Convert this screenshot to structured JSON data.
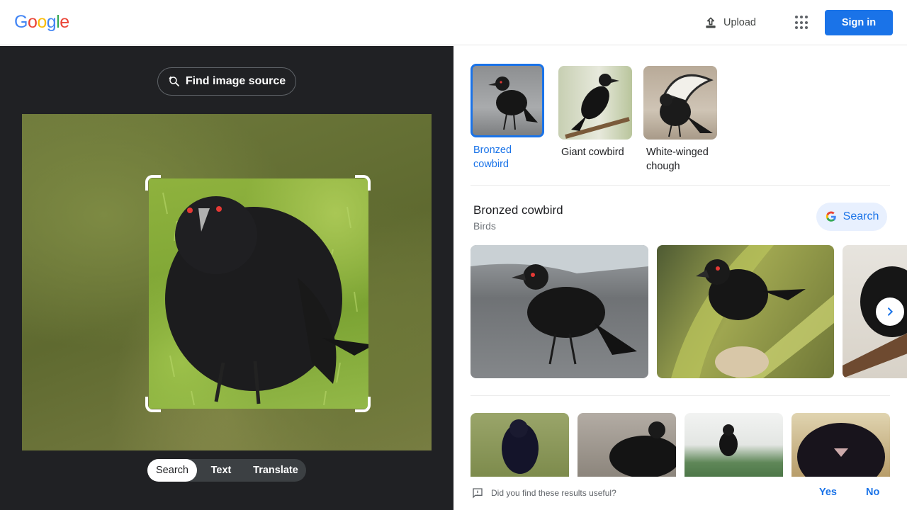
{
  "header": {
    "logo_letters": [
      {
        "ch": "G",
        "color": "#4285f4"
      },
      {
        "ch": "o",
        "color": "#ea4335"
      },
      {
        "ch": "o",
        "color": "#fbbc05"
      },
      {
        "ch": "g",
        "color": "#4285f4"
      },
      {
        "ch": "l",
        "color": "#34a853"
      },
      {
        "ch": "e",
        "color": "#ea4335"
      }
    ],
    "upload_label": "Upload",
    "upload_icon": "upload-icon",
    "apps_icon": "apps-grid-icon",
    "signin_label": "Sign in"
  },
  "left_panel": {
    "find_source_label": "Find image source",
    "find_source_icon": "lens-search-icon",
    "modes": [
      "Search",
      "Text",
      "Translate"
    ],
    "active_mode": "Search"
  },
  "matches": [
    {
      "label": "Bronzed cowbird",
      "selected": true
    },
    {
      "label": "Giant cowbird",
      "selected": false
    },
    {
      "label": "White-winged chough",
      "selected": false
    }
  ],
  "result": {
    "title": "Bronzed cowbird",
    "subtitle": "Birds",
    "search_label": "Search",
    "search_icon": "google-g-icon",
    "next_icon": "chevron-right-icon"
  },
  "feedback": {
    "question": "Did you find these results useful?",
    "icon": "feedback-icon",
    "yes": "Yes",
    "no": "No"
  },
  "colors": {
    "accent": "#1a73e8",
    "dark_panel": "#202124",
    "bird": "#1c1c1e",
    "eye": "#e53935"
  }
}
